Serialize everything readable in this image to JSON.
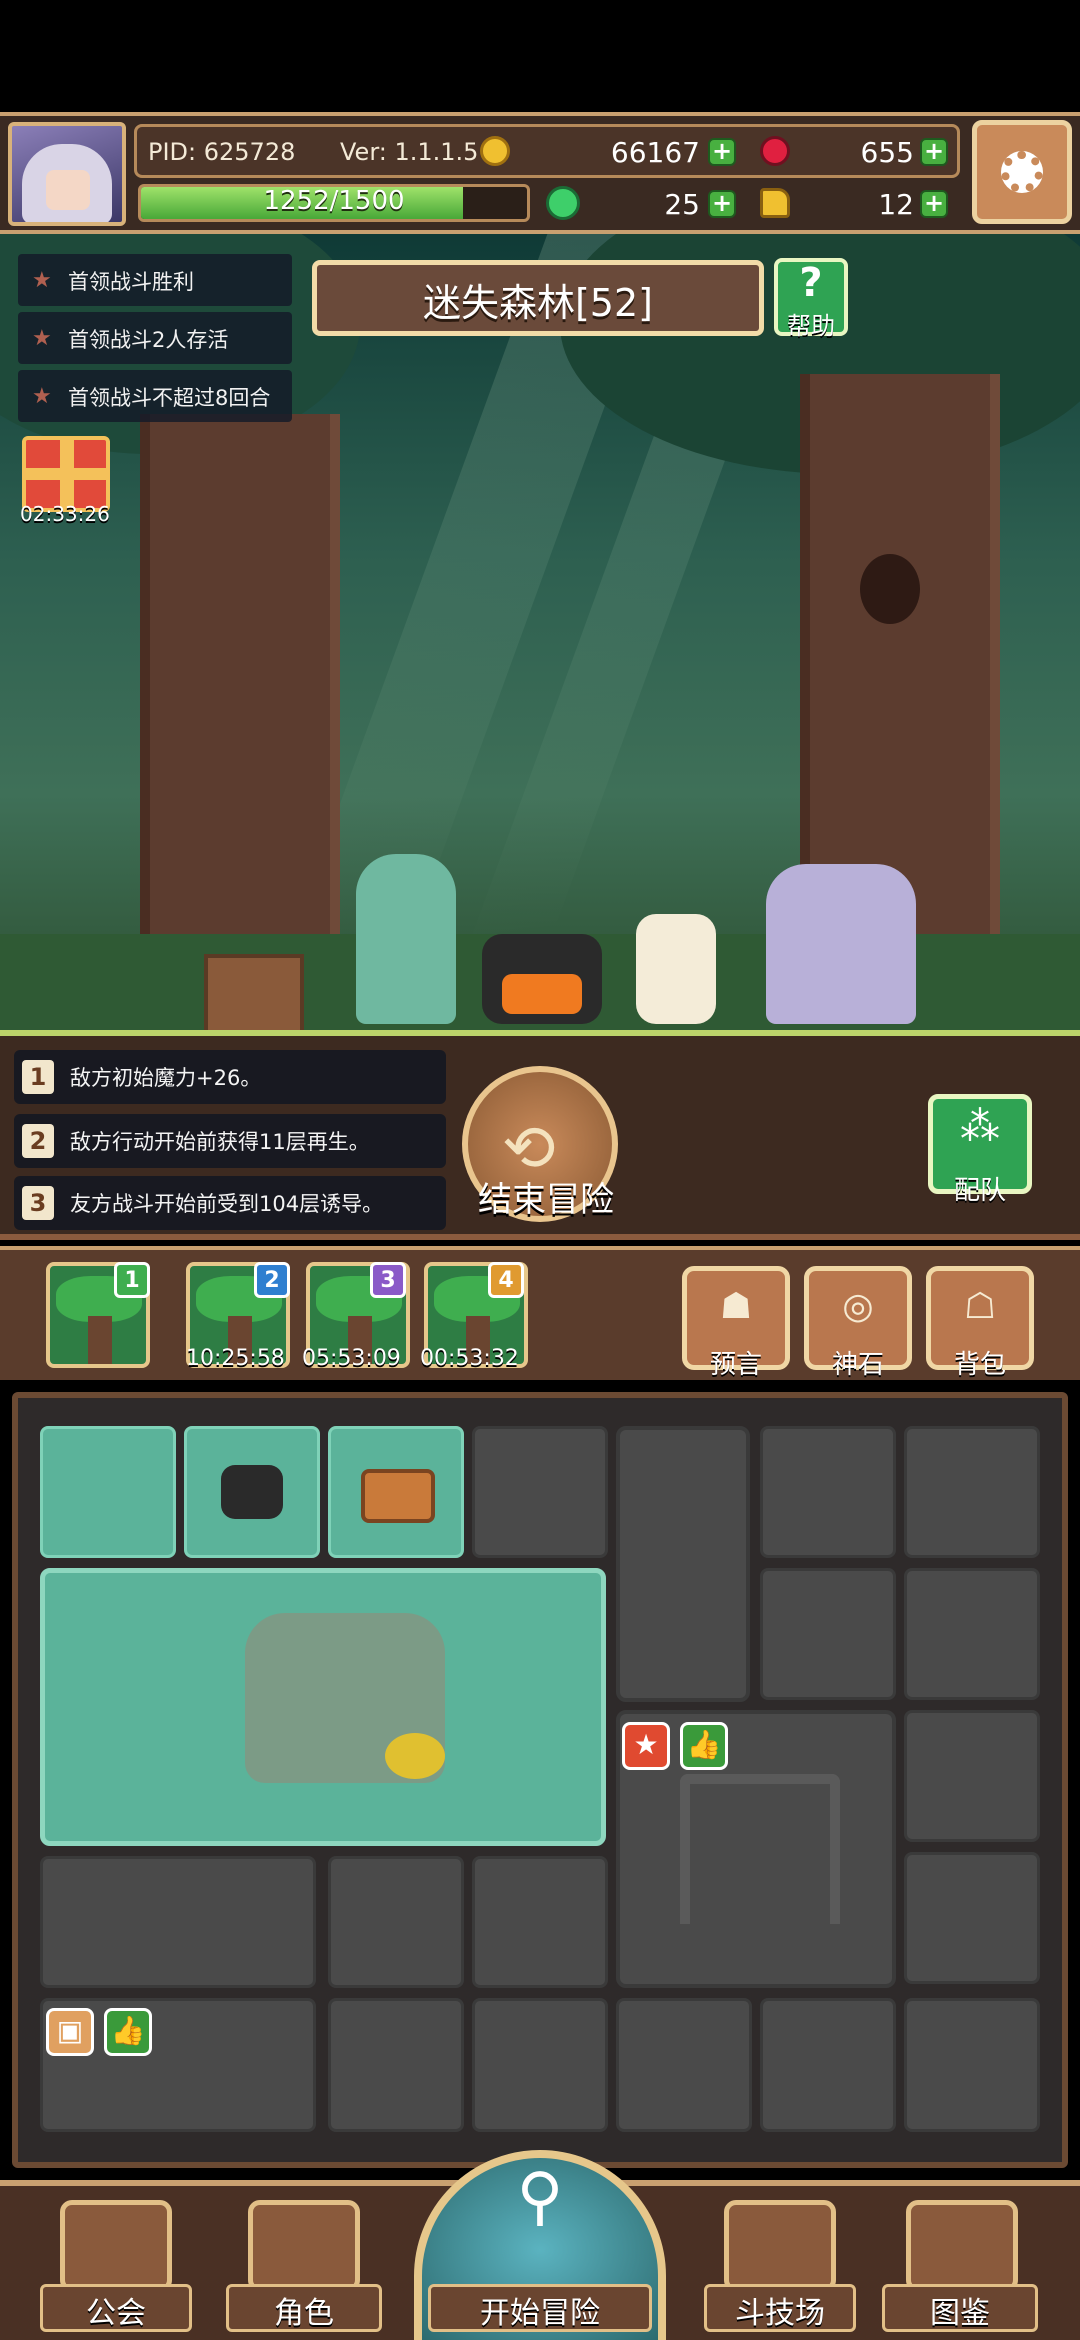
{
  "header": {
    "pid": "PID: 625728",
    "version": "Ver: 1.1.1.5",
    "gold": "66167",
    "gems": "655",
    "exp_text": "1252/1500",
    "exp_progress": 0.835,
    "clover": "25",
    "keys": "12"
  },
  "quests": [
    {
      "label": "首领战斗胜利"
    },
    {
      "label": "首领战斗2人存活"
    },
    {
      "label": "首领战斗不超过8回合"
    }
  ],
  "gift": {
    "timer": "02:33:26"
  },
  "stage": {
    "title": "迷失森林[52]",
    "help": "帮助"
  },
  "effects": [
    {
      "num": "1",
      "text": "敌方初始魔力+26。"
    },
    {
      "num": "2",
      "text": "敌方行动开始前获得11层再生。"
    },
    {
      "num": "3",
      "text": "友方战斗开始前受到104层诱导。"
    }
  ],
  "actions": {
    "end": "结束冒险",
    "team": "配队"
  },
  "floors": [
    {
      "badge": "1",
      "badge_color": "#3fae4f",
      "time": ""
    },
    {
      "badge": "2",
      "badge_color": "#2f7fd0",
      "time": "10:25:58"
    },
    {
      "badge": "3",
      "badge_color": "#8a5ac8",
      "time": "05:53:09"
    },
    {
      "badge": "4",
      "badge_color": "#e09a30",
      "time": "00:53:32"
    }
  ],
  "tools": [
    {
      "label": "预言",
      "icon": "prophecy-icon"
    },
    {
      "label": "神石",
      "icon": "divine-stone-icon"
    },
    {
      "label": "背包",
      "icon": "backpack-icon"
    }
  ],
  "nav": {
    "guild": "公会",
    "character": "角色",
    "start": "开始冒险",
    "arena": "斗技场",
    "codex": "图鉴"
  },
  "colors": {
    "accent": "#c9a070",
    "green": "#48b040",
    "panel": "#3d2a20"
  }
}
